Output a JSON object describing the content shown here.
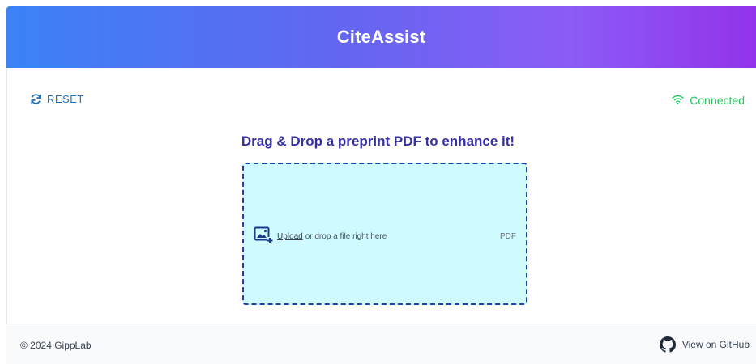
{
  "header": {
    "title": "CiteAssist",
    "gradient_start": "#3b82f6",
    "gradient_end": "#9333ea"
  },
  "toolbar": {
    "reset_label": "RESET",
    "reset_icon": "refresh-icon",
    "status_label": "Connected",
    "status_icon": "wifi-icon",
    "status_color": "#22c55e"
  },
  "main": {
    "prompt": "Drag & Drop a preprint PDF to enhance it!",
    "dropzone": {
      "upload_link": "Upload",
      "hint": "or drop a file right here",
      "file_type": "PDF",
      "icon": "image-add-icon",
      "background": "#cffafe"
    }
  },
  "footer": {
    "copyright": "© 2024 GippLab",
    "github_label": "View on GitHub",
    "github_icon": "github-icon"
  }
}
